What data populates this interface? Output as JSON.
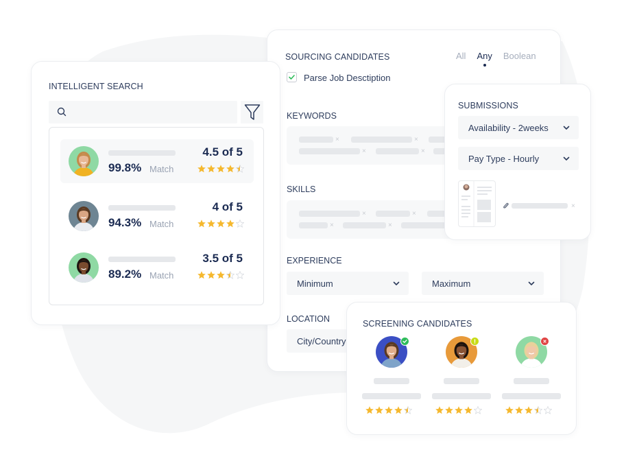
{
  "colors": {
    "star_filled": "#f5b82e",
    "star_empty": "#d8dbe0",
    "heading": "#2d3c5c",
    "emphasis": "#1b2b52",
    "muted": "#9aa3b3",
    "status_approved": "#2ebc5a",
    "status_pending": "#c8dc16",
    "status_rejected": "#e04444"
  },
  "intelligent_search": {
    "title": "INTELLIGENT SEARCH",
    "search_icon": "search-icon",
    "filter_icon": "filter-icon",
    "results": [
      {
        "match_percent": "99.8%",
        "match_label": "Match",
        "rating_text": "4.5 of 5",
        "rating": 4.5,
        "avatar_bg": "#8fd9a4",
        "skin": "#e8b896",
        "hair": "#c48a4a",
        "shirt": "#f0b223",
        "active": true
      },
      {
        "match_percent": "94.3%",
        "match_label": "Match",
        "rating_text": "4 of 5",
        "rating": 4,
        "avatar_bg": "#6e8593",
        "skin": "#d9a684",
        "hair": "#5a3a22",
        "shirt": "#e9ecf1",
        "active": false
      },
      {
        "match_percent": "89.2%",
        "match_label": "Match",
        "rating_text": "3.5 of 5",
        "rating": 3.5,
        "avatar_bg": "#8fd9a4",
        "skin": "#7a4b2e",
        "hair": "#1e1410",
        "shirt": "#dfe3ea",
        "active": false
      }
    ]
  },
  "sourcing": {
    "title": "SOURCING CANDIDATES",
    "modes": [
      "All",
      "Any",
      "Boolean"
    ],
    "active_mode": "Any",
    "parse_checkbox": {
      "label": "Parse Job Desctiption",
      "checked": true
    },
    "keywords_label": "KEYWORDS",
    "skills_label": "SKILLS",
    "experience_label": "EXPERIENCE",
    "experience_min": "Minimum",
    "experience_max": "Maximum",
    "location_label": "LOCATION",
    "location_placeholder": "City/Country"
  },
  "submissions": {
    "title": "SUBMISSIONS",
    "availability": "Availability - 2weeks",
    "pay_type": "Pay Type - Hourly",
    "attachment_icon": "paperclip-icon"
  },
  "screening": {
    "title": "SCREENING CANDIDATES",
    "candidates": [
      {
        "status": "approved",
        "rating": 4.5,
        "avatar_bg": "#3b4fc4",
        "skin": "#e0ad8a",
        "hair": "#5b3a22",
        "shirt": "#7fa4c9"
      },
      {
        "status": "pending",
        "rating": 4,
        "avatar_bg": "#e89a3a",
        "skin": "#8a5434",
        "hair": "#1e130d",
        "shirt": "#f2efe9"
      },
      {
        "status": "rejected",
        "rating": 3.5,
        "avatar_bg": "#8fd9a4",
        "skin": "#f0c8a8",
        "hair": "#e8d29a",
        "shirt": "#ffffff"
      }
    ]
  }
}
